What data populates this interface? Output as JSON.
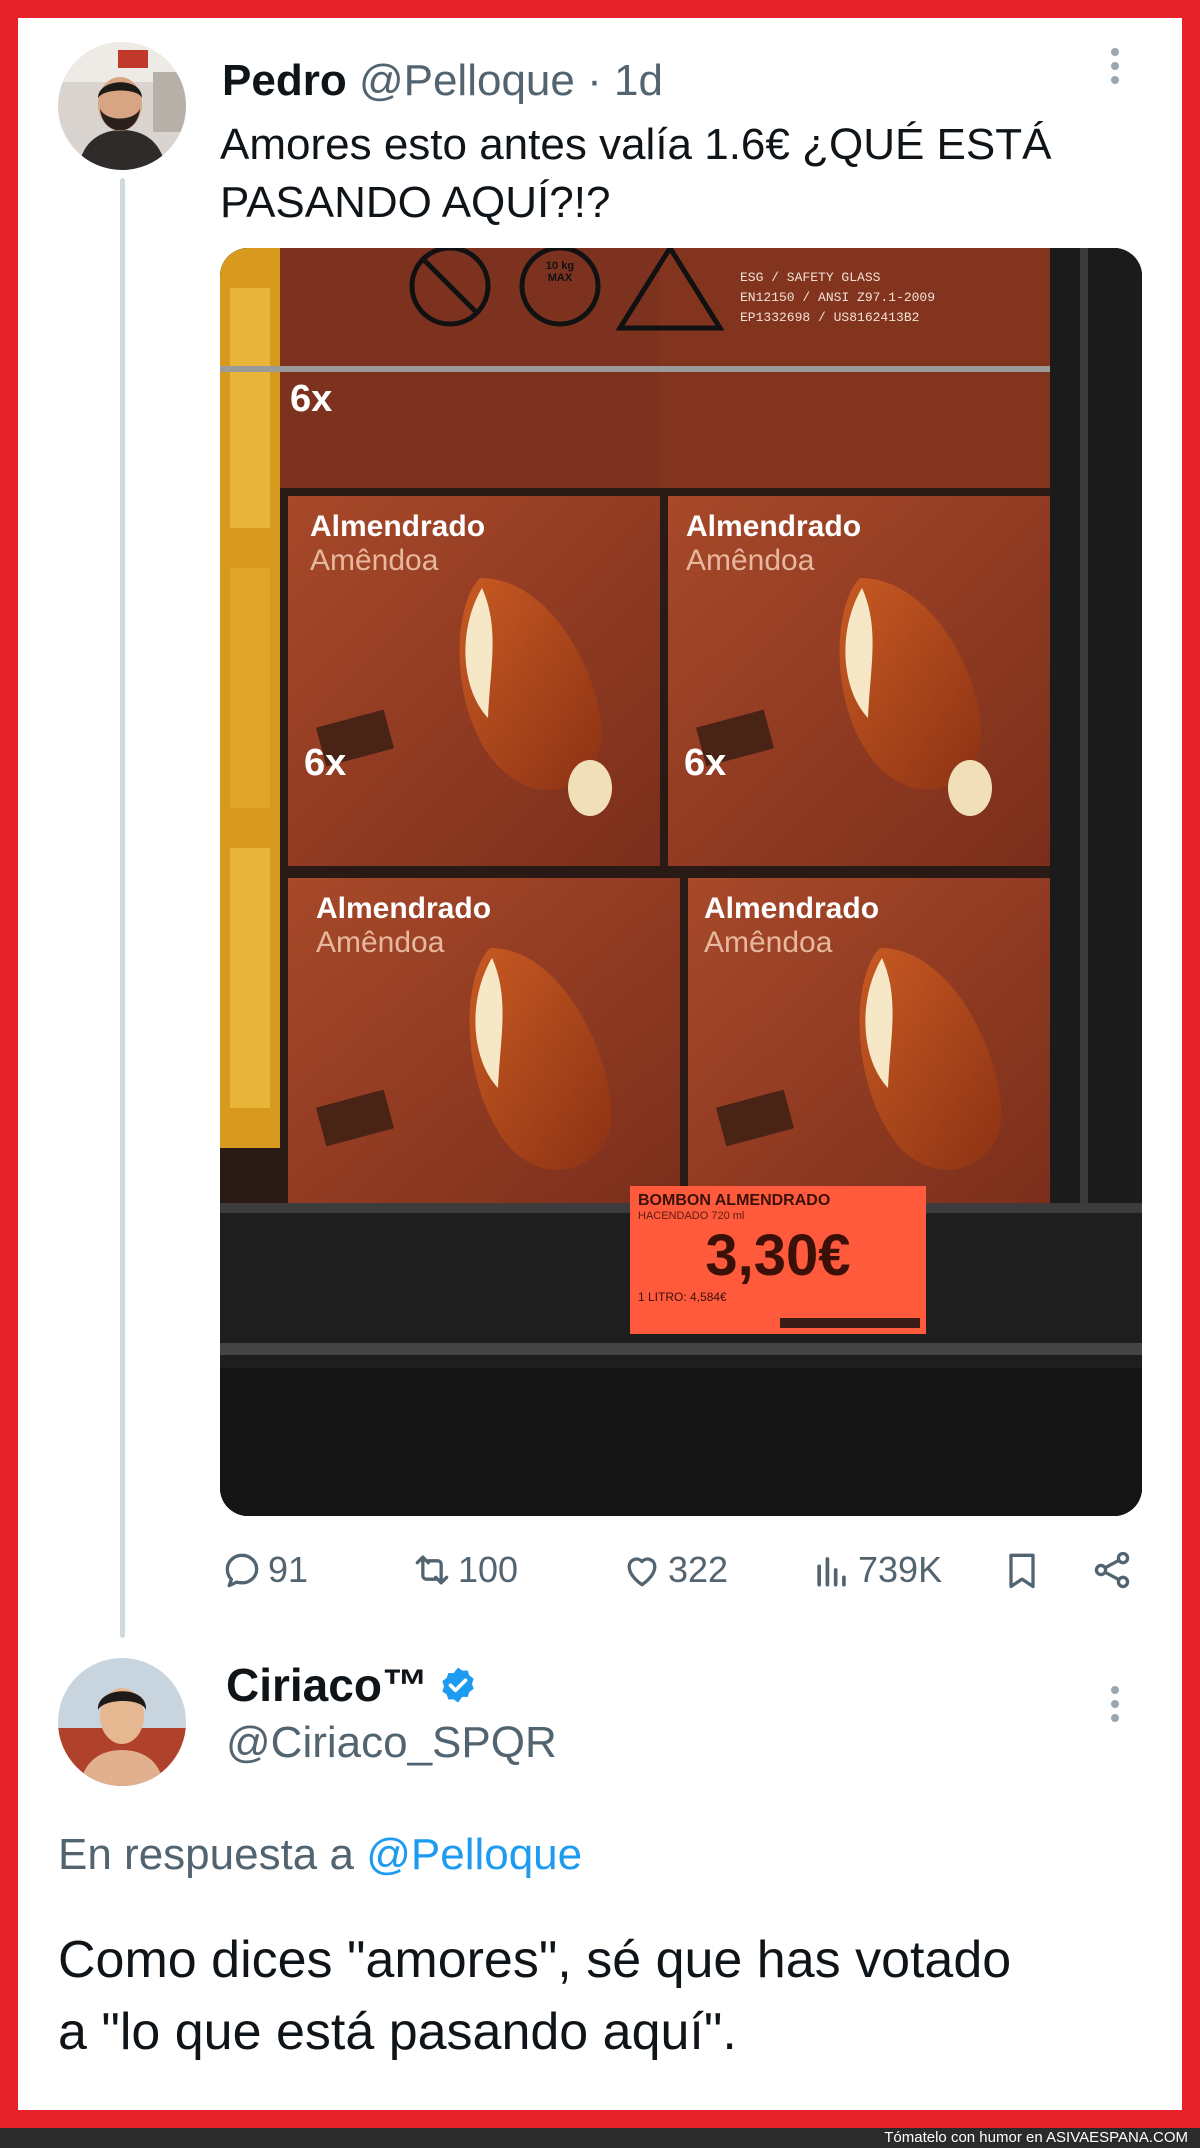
{
  "tweet": {
    "author_name": "Pedro",
    "handle": "@Pelloque",
    "separator": "·",
    "time": "1d",
    "text_line1": "Amores esto antes valía 1.6€ ¿QUÉ ESTÁ",
    "text_line2": "PASANDO AQUÍ?!?",
    "photo": {
      "warning_text1": "ESG / SAFETY GLASS",
      "warning_text2": "EN12150 / ANSI Z97.1-2009",
      "warning_text3": "EP1332698 / US8162413B2",
      "weight_label": "10 kg MAX",
      "product_name": "Almendrado",
      "product_subname": "Amêndoa",
      "pack_count": "6x",
      "price_product": "BOMBON ALMENDRADO",
      "price_brand": "HACENDADO 720 ml",
      "price_value": "3,30€",
      "price_per_litre": "1 LITRO: 4,584€"
    },
    "stats": {
      "replies": "91",
      "retweets": "100",
      "likes": "322",
      "views": "739K"
    }
  },
  "reply": {
    "author_name": "Ciriaco™",
    "handle": "@Ciriaco_SPQR",
    "in_reply_prefix": "En respuesta a",
    "in_reply_mention": "@Pelloque",
    "text_line1": "Como dices \"amores\", sé que has votado",
    "text_line2": "a \"lo que está pasando aquí\"."
  },
  "footer": {
    "text_prefix": "Tómatelo con humor en",
    "site": "ASIVAESPANA.COM"
  },
  "colors": {
    "frame": "#e8222a",
    "text": "#0f1419",
    "muted": "#536471",
    "link": "#1d9bf0",
    "price_tag": "#ff5a3c"
  }
}
